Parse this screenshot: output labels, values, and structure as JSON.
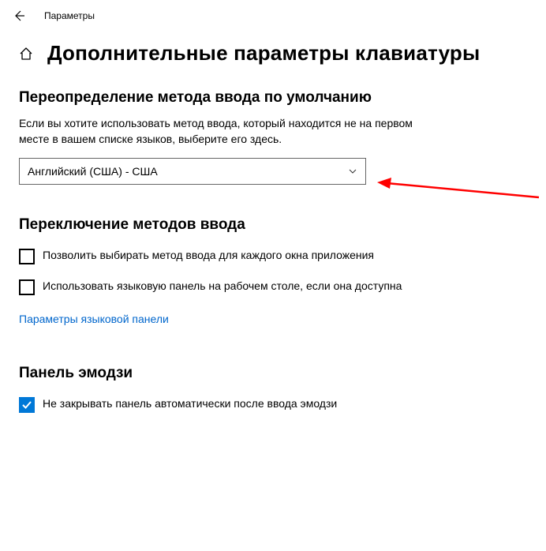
{
  "titlebar": {
    "title": "Параметры"
  },
  "header": {
    "page_title": "Дополнительные параметры клавиатуры"
  },
  "section1": {
    "heading": "Переопределение метода ввода по умолчанию",
    "description": "Если вы хотите использовать метод ввода, который находится не на первом месте в вашем списке языков, выберите его здесь.",
    "dropdown_value": "Английский (США) - США"
  },
  "section2": {
    "heading": "Переключение методов ввода",
    "checkbox1_label": "Позволить выбирать метод ввода для каждого окна приложения",
    "checkbox2_label": "Использовать языковую панель на рабочем столе, если она доступна",
    "link": "Параметры языковой панели"
  },
  "section3": {
    "heading": "Панель эмодзи",
    "checkbox_label": "Не закрывать панель автоматически после ввода эмодзи"
  }
}
